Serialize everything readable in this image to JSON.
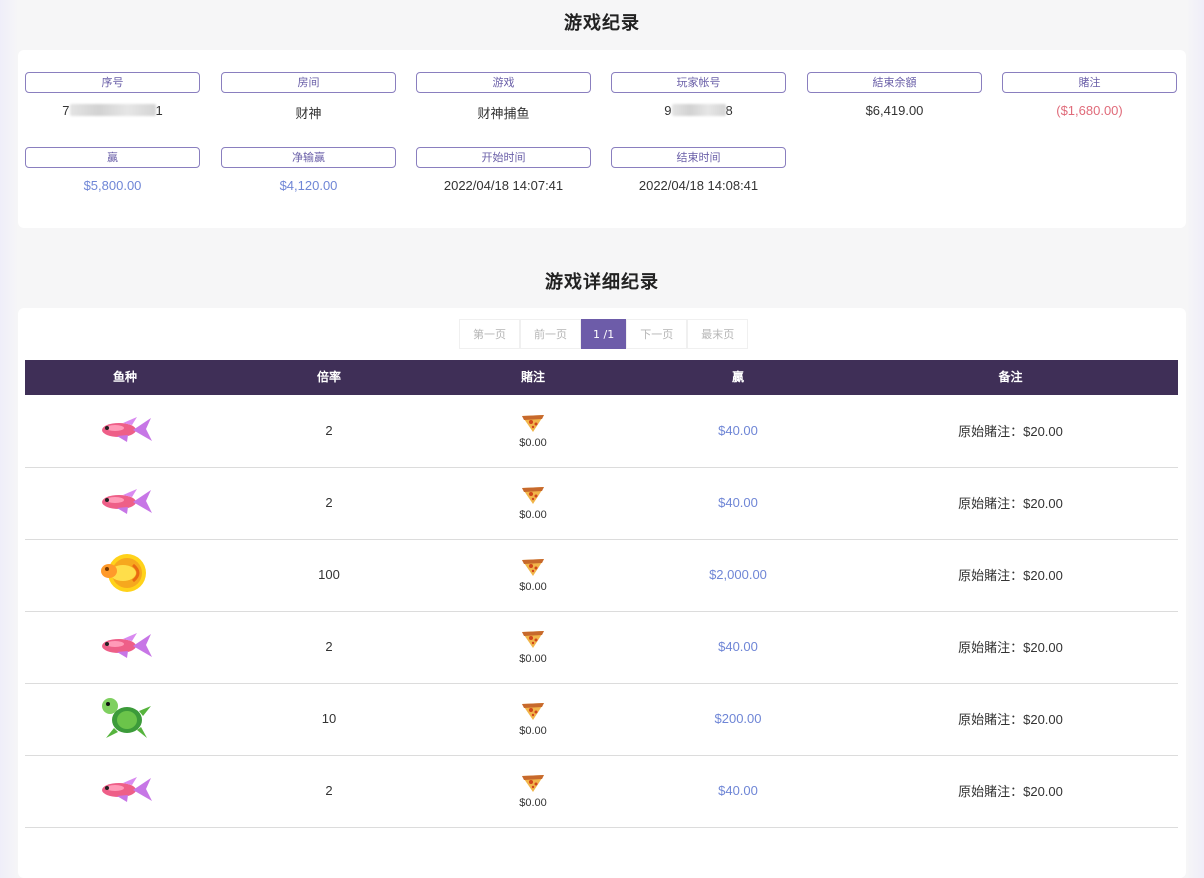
{
  "record_title": "游戏纪录",
  "record": {
    "fields": [
      {
        "label": "序号",
        "value_prefix": "7",
        "value_suffix": "1",
        "masked": true,
        "tone": "normal"
      },
      {
        "label": "房间",
        "value": "财神",
        "tone": "normal"
      },
      {
        "label": "游戏",
        "value": "财神捕鱼",
        "tone": "normal"
      },
      {
        "label": "玩家帐号",
        "value_prefix": "9",
        "value_suffix": "8",
        "masked": true,
        "tone": "normal"
      },
      {
        "label": "結束余額",
        "value": "$6,419.00",
        "tone": "normal"
      },
      {
        "label": "賭注",
        "value": "($1,680.00)",
        "tone": "red"
      },
      {
        "label": "贏",
        "value": "$5,800.00",
        "tone": "blue"
      },
      {
        "label": "净输赢",
        "value": "$4,120.00",
        "tone": "blue"
      },
      {
        "label": "开始时间",
        "value": "2022/04/18 14:07:41",
        "tone": "normal"
      },
      {
        "label": "结束时间",
        "value": "2022/04/18 14:08:41",
        "tone": "normal"
      }
    ]
  },
  "detail_title": "游戏详细纪录",
  "pager": {
    "first": "第一页",
    "prev": "前一页",
    "current": "1 /1",
    "next": "下一页",
    "last": "最末页"
  },
  "table": {
    "headers": [
      "鱼种",
      "倍率",
      "賭注",
      "贏",
      "备注"
    ],
    "rows": [
      {
        "fish_icon": "pink-fish-icon",
        "rate": "2",
        "bet": "$0.00",
        "win": "$40.00",
        "remark": "原始賭注：$20.00"
      },
      {
        "fish_icon": "pink-fish-icon",
        "rate": "2",
        "bet": "$0.00",
        "win": "$40.00",
        "remark": "原始賭注：$20.00"
      },
      {
        "fish_icon": "golden-fish-icon",
        "rate": "100",
        "bet": "$0.00",
        "win": "$2,000.00",
        "remark": "原始賭注：$20.00"
      },
      {
        "fish_icon": "pink-fish-icon",
        "rate": "2",
        "bet": "$0.00",
        "win": "$40.00",
        "remark": "原始賭注：$20.00"
      },
      {
        "fish_icon": "green-turtle-icon",
        "rate": "10",
        "bet": "$0.00",
        "win": "$200.00",
        "remark": "原始賭注：$20.00"
      },
      {
        "fish_icon": "pink-fish-icon",
        "rate": "2",
        "bet": "$0.00",
        "win": "$40.00",
        "remark": "原始賭注：$20.00"
      }
    ]
  },
  "colors": {
    "accent": "#6d5ca9",
    "table_header": "#3f2f57",
    "win": "#6f86d6",
    "loss": "#e06b7a"
  }
}
